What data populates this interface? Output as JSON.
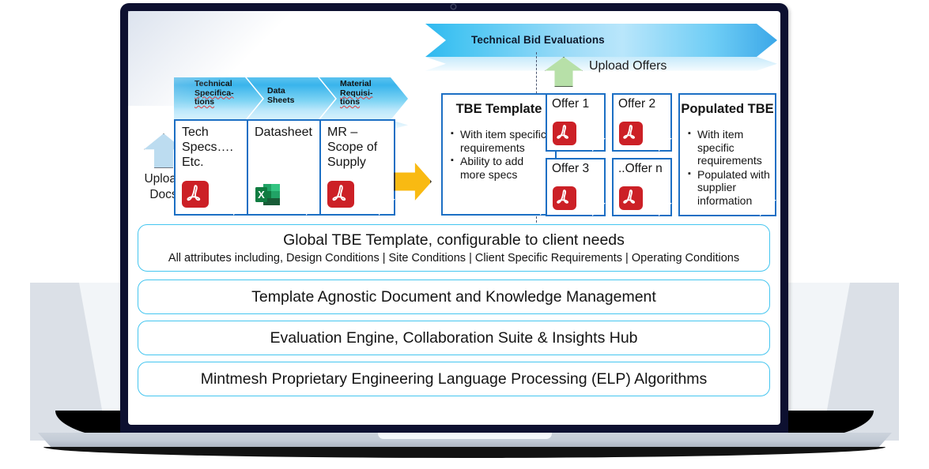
{
  "device": {
    "type": "laptop",
    "camera": "camera-dot"
  },
  "banner": {
    "label": "Technical Bid Evaluations",
    "color": "#46c4f2"
  },
  "upload_docs": {
    "arrow_icon": "arrow-up-icon",
    "line1": "Upload",
    "line2": "Docs",
    "color": "#bcdcf0"
  },
  "upload_offers": {
    "arrow_icon": "arrow-up-icon",
    "label": "Upload Offers",
    "color": "#b7e0a8"
  },
  "process_steps": [
    {
      "line1": "Technical",
      "line2": "Specifica-",
      "line3": "tions"
    },
    {
      "line1": "Data",
      "line2": "Sheets",
      "line3": ""
    },
    {
      "line1": "Material",
      "line2": "Requisi-",
      "line3": "tions"
    }
  ],
  "source_documents": [
    {
      "title": "Tech\nSpecs….\nEtc.",
      "file_icon": "pdf-icon"
    },
    {
      "title": "Datasheet",
      "file_icon": "excel-icon"
    },
    {
      "title": "MR –\nScope of\nSupply",
      "file_icon": "pdf-icon"
    }
  ],
  "transform_arrow": {
    "icon": "arrow-right-icon",
    "color": "#f9ba12"
  },
  "tbe_template": {
    "title": "TBE Template",
    "bullets": [
      "With item specific requirements",
      "Ability to add more specs"
    ]
  },
  "offers": [
    {
      "label": "Offer 1",
      "file_icon": "pdf-icon"
    },
    {
      "label": "Offer 2",
      "file_icon": "pdf-icon"
    },
    {
      "label": "Offer 3",
      "file_icon": "pdf-icon"
    },
    {
      "label": "..Offer n",
      "file_icon": "pdf-icon"
    }
  ],
  "populated_tbe": {
    "title": "Populated TBE",
    "bullets": [
      "With item specific requirements",
      "Populated with supplier information"
    ]
  },
  "platform_layers": [
    {
      "line1": "Global TBE Template, configurable to client needs",
      "line2": "All attributes including, Design Conditions | Site Conditions | Client Specific Requirements | Operating Conditions"
    },
    {
      "line1": "Template Agnostic Document and Knowledge Management",
      "line2": ""
    },
    {
      "line1": "Evaluation Engine, Collaboration Suite & Insights Hub",
      "line2": ""
    },
    {
      "line1": "Mintmesh Proprietary Engineering Language Processing (ELP) Algorithms",
      "line2": ""
    }
  ],
  "colors": {
    "bezel": "#0d1030",
    "card_border": "#1c6fc4",
    "bar_border": "#45c6f0",
    "pdf_red": "#cc2026",
    "excel_green": "#1d7044"
  }
}
